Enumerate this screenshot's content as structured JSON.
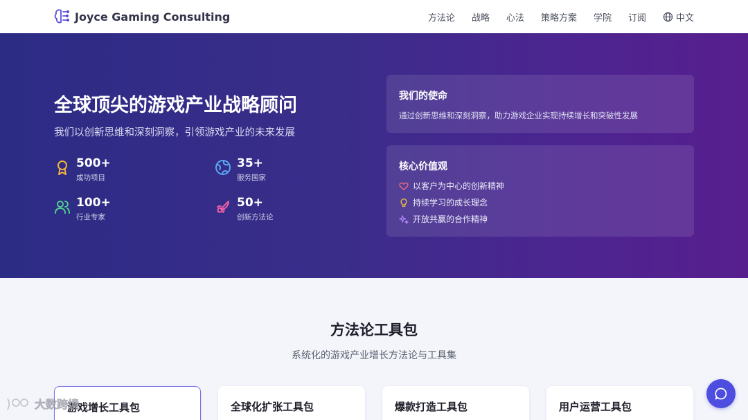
{
  "header": {
    "brand": "Joyce Gaming Consulting",
    "nav": [
      "方法论",
      "战略",
      "心法",
      "策略方案",
      "学院",
      "订阅"
    ],
    "language": "中文"
  },
  "hero": {
    "title": "全球顶尖的游戏产业战略顾问",
    "subtitle": "我们以创新思维和深刻洞察，引领游戏产业的未来发展",
    "stats": [
      {
        "value": "500+",
        "label": "成功项目",
        "icon": "award-icon"
      },
      {
        "value": "35+",
        "label": "服务国家",
        "icon": "globe-icon"
      },
      {
        "value": "100+",
        "label": "行业专家",
        "icon": "users-icon"
      },
      {
        "value": "50+",
        "label": "创新方法论",
        "icon": "rocket-icon"
      }
    ],
    "mission": {
      "title": "我们的使命",
      "text": "通过创新思维和深刻洞察，助力游戏企业实现持续增长和突破性发展"
    },
    "values": {
      "title": "核心价值观",
      "items": [
        "以客户为中心的创新精神",
        "持续学习的成长理念",
        "开放共赢的合作精神"
      ]
    }
  },
  "toolkit": {
    "title": "方法论工具包",
    "subtitle": "系统化的游戏产业增长方法论与工具集",
    "cards": [
      "游戏增长工具包",
      "全球化扩张工具包",
      "爆款打造工具包",
      "用户运营工具包"
    ]
  },
  "watermark": "大数跨境",
  "colors": {
    "accent": "#4d4de0",
    "hero_start": "#2c2c85",
    "hero_end": "#571f8e"
  }
}
